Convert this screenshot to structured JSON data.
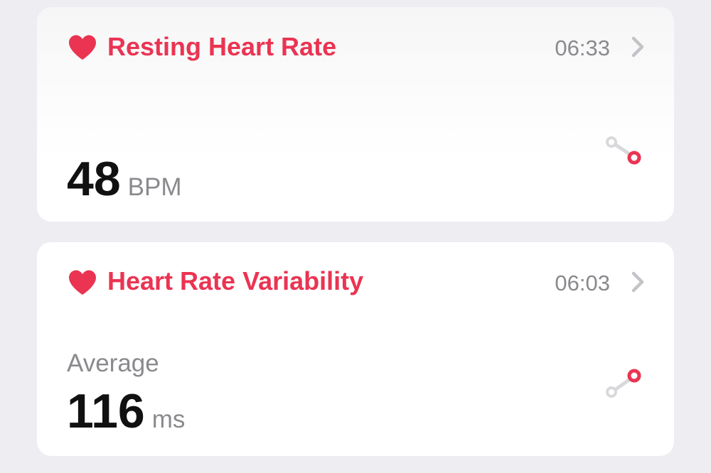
{
  "colors": {
    "accent": "#ea3452",
    "secondary_text": "#8a8a8e",
    "primary_text": "#111111",
    "page_background": "#eeedf2",
    "card_background": "#ffffff"
  },
  "cards": [
    {
      "icon": "heart-icon",
      "title": "Resting Heart Rate",
      "time": "06:33",
      "value": "48",
      "unit": "BPM",
      "trend_icon": "trend-down-icon"
    },
    {
      "icon": "heart-icon",
      "title": "Heart Rate Variability",
      "time": "06:03",
      "label": "Average",
      "value": "116",
      "unit": "ms",
      "trend_icon": "trend-up-icon"
    }
  ]
}
